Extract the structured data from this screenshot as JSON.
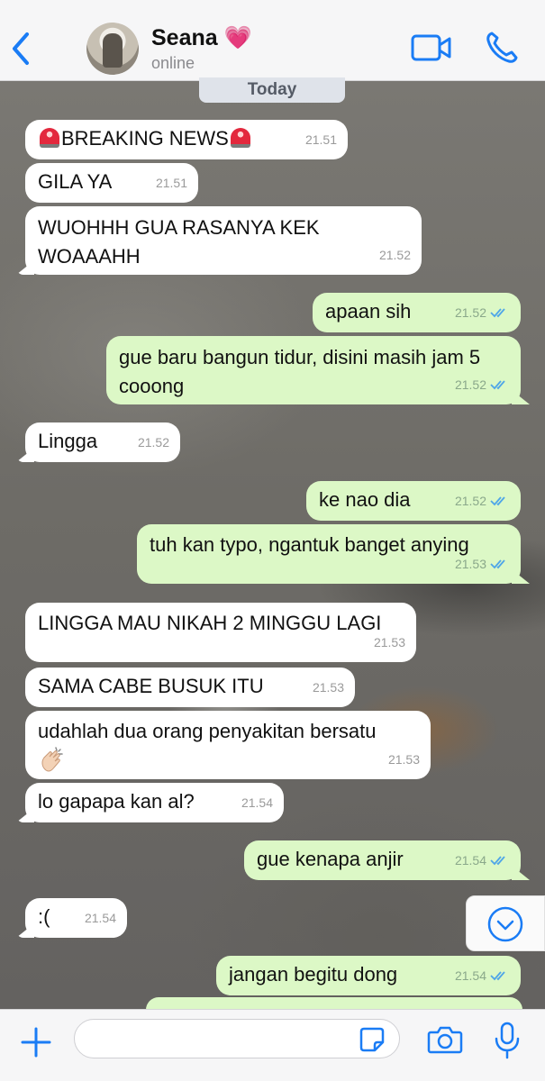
{
  "header": {
    "contact_name": "Seana 💗",
    "status": "online"
  },
  "date_label": "Today",
  "messages": [
    {
      "dir": "in",
      "text": "BREAKING NEWS",
      "time": "21.51"
    },
    {
      "dir": "in",
      "text": "GILA YA",
      "time": "21.51"
    },
    {
      "dir": "in",
      "text": "WUOHHH GUA RASANYA KEK WOAAAHH",
      "time": "21.52"
    },
    {
      "dir": "out",
      "text": "apaan sih",
      "time": "21.52"
    },
    {
      "dir": "out",
      "text": "gue baru bangun tidur, disini masih jam 5 cooong",
      "time": "21.52"
    },
    {
      "dir": "in",
      "text": "Lingga",
      "time": "21.52"
    },
    {
      "dir": "out",
      "text": "ke nao dia",
      "time": "21.52"
    },
    {
      "dir": "out",
      "text": "tuh kan typo, ngantuk banget anying",
      "time": "21.53"
    },
    {
      "dir": "in",
      "text": "LINGGA MAU NIKAH 2 MINGGU LAGI",
      "time": "21.53"
    },
    {
      "dir": "in",
      "text": "SAMA CABE BUSUK ITU",
      "time": "21.53"
    },
    {
      "dir": "in",
      "text": "udahlah dua orang penyakitan bersatu",
      "time": "21.53"
    },
    {
      "dir": "in",
      "text": "lo gapapa kan al?",
      "time": "21.54"
    },
    {
      "dir": "out",
      "text": "gue kenapa anjir",
      "time": "21.54"
    },
    {
      "dir": "in",
      "text": ":(",
      "time": "21.54"
    },
    {
      "dir": "out",
      "text": "jangan begitu dong",
      "time": "21.54"
    }
  ],
  "input": {
    "placeholder": ""
  },
  "colors": {
    "accent": "#1a7cf5",
    "incoming_bubble": "#ffffff",
    "outgoing_bubble": "#dcf8c6",
    "read_ticks": "#4fa6e8"
  },
  "icons": [
    "back-chevron-icon",
    "video-call-icon",
    "phone-icon",
    "siren-emoji",
    "clapping-hands-emoji",
    "chevron-down-icon",
    "plus-icon",
    "sticker-icon",
    "camera-icon",
    "microphone-icon"
  ]
}
